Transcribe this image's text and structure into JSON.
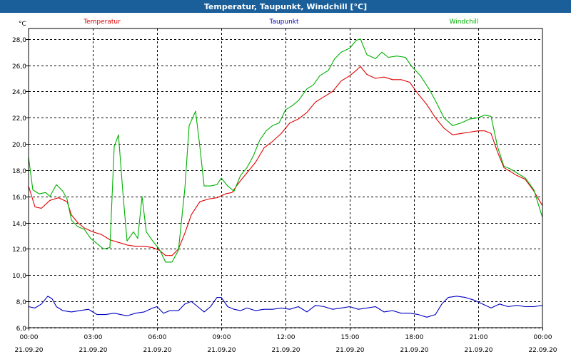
{
  "window": {
    "title": "Temperatur, Taupunkt, Windchill [°C]"
  },
  "colors": {
    "titlebar": "#1a5e9a",
    "temperatur": "#e00000",
    "taupunkt": "#0000c0",
    "windchill": "#00b000",
    "grid": "#000000"
  },
  "chart_data": {
    "type": "line",
    "title": "Temperatur, Taupunkt, Windchill [°C]",
    "ylabel": "°C",
    "ylim": [
      6.0,
      28.8
    ],
    "yticks": [
      "28,0",
      "26,0",
      "24,0",
      "22,0",
      "20,0",
      "18,0",
      "16,0",
      "14,0",
      "12,0",
      "10,0",
      "8,0",
      "6,0"
    ],
    "ytick_values": [
      28,
      26,
      24,
      22,
      20,
      18,
      16,
      14,
      12,
      10,
      8,
      6
    ],
    "xlim": [
      0,
      24
    ],
    "xticks": [
      {
        "time": "00:00",
        "date": "21.09.20"
      },
      {
        "time": "03:00",
        "date": "21.09.20"
      },
      {
        "time": "06:00",
        "date": "21.09.20"
      },
      {
        "time": "09:00",
        "date": "21.09.20"
      },
      {
        "time": "12:00",
        "date": "21.09.20"
      },
      {
        "time": "15:00",
        "date": "21.09.20"
      },
      {
        "time": "18:00",
        "date": "21.09.20"
      },
      {
        "time": "21:00",
        "date": "21.09.20"
      },
      {
        "time": "00:00",
        "date": "22.09.20"
      }
    ],
    "grid": true,
    "legend_position": "top",
    "series": [
      {
        "name": "Temperatur",
        "color": "#e00000",
        "points": [
          [
            0,
            16.8
          ],
          [
            0.3,
            15.2
          ],
          [
            0.6,
            15.1
          ],
          [
            1.0,
            15.7
          ],
          [
            1.4,
            15.9
          ],
          [
            1.8,
            15.6
          ],
          [
            2.0,
            14.6
          ],
          [
            2.3,
            14.0
          ],
          [
            2.6,
            13.6
          ],
          [
            3.0,
            13.3
          ],
          [
            3.4,
            13.1
          ],
          [
            3.8,
            12.7
          ],
          [
            4.2,
            12.5
          ],
          [
            4.6,
            12.3
          ],
          [
            5.0,
            12.2
          ],
          [
            5.4,
            12.2
          ],
          [
            5.8,
            12.1
          ],
          [
            6.1,
            11.9
          ],
          [
            6.4,
            11.5
          ],
          [
            6.7,
            11.5
          ],
          [
            7.0,
            12.0
          ],
          [
            7.3,
            13.2
          ],
          [
            7.6,
            14.6
          ],
          [
            8.0,
            15.6
          ],
          [
            8.4,
            15.8
          ],
          [
            8.8,
            15.9
          ],
          [
            9.2,
            16.2
          ],
          [
            9.5,
            16.3
          ],
          [
            9.8,
            17.0
          ],
          [
            10.2,
            17.8
          ],
          [
            10.6,
            18.6
          ],
          [
            11.0,
            19.7
          ],
          [
            11.4,
            20.2
          ],
          [
            11.8,
            20.8
          ],
          [
            12.2,
            21.6
          ],
          [
            12.6,
            21.9
          ],
          [
            13.0,
            22.4
          ],
          [
            13.4,
            23.2
          ],
          [
            13.8,
            23.6
          ],
          [
            14.2,
            24.0
          ],
          [
            14.6,
            24.8
          ],
          [
            15.0,
            25.2
          ],
          [
            15.3,
            25.6
          ],
          [
            15.5,
            25.9
          ],
          [
            15.8,
            25.3
          ],
          [
            16.2,
            25.0
          ],
          [
            16.6,
            25.1
          ],
          [
            17.0,
            24.9
          ],
          [
            17.4,
            24.9
          ],
          [
            17.8,
            24.7
          ],
          [
            18.2,
            23.8
          ],
          [
            18.6,
            23.0
          ],
          [
            19.0,
            22.0
          ],
          [
            19.4,
            21.2
          ],
          [
            19.8,
            20.7
          ],
          [
            20.2,
            20.8
          ],
          [
            20.6,
            20.9
          ],
          [
            21.0,
            21.0
          ],
          [
            21.3,
            21.0
          ],
          [
            21.6,
            20.8
          ],
          [
            21.9,
            19.4
          ],
          [
            22.2,
            18.2
          ],
          [
            22.5,
            17.9
          ],
          [
            22.8,
            17.6
          ],
          [
            23.2,
            17.3
          ],
          [
            23.6,
            16.4
          ],
          [
            24.0,
            15.3
          ]
        ]
      },
      {
        "name": "Taupunkt",
        "color": "#0000c0",
        "points": [
          [
            0,
            7.6
          ],
          [
            0.3,
            7.5
          ],
          [
            0.6,
            7.8
          ],
          [
            0.9,
            8.4
          ],
          [
            1.1,
            8.2
          ],
          [
            1.3,
            7.6
          ],
          [
            1.6,
            7.3
          ],
          [
            2.0,
            7.2
          ],
          [
            2.4,
            7.3
          ],
          [
            2.8,
            7.4
          ],
          [
            3.2,
            7.0
          ],
          [
            3.6,
            7.0
          ],
          [
            4.0,
            7.1
          ],
          [
            4.3,
            7.0
          ],
          [
            4.6,
            6.9
          ],
          [
            5.0,
            7.1
          ],
          [
            5.4,
            7.2
          ],
          [
            5.8,
            7.5
          ],
          [
            6.0,
            7.6
          ],
          [
            6.3,
            7.1
          ],
          [
            6.6,
            7.3
          ],
          [
            7.0,
            7.3
          ],
          [
            7.3,
            7.8
          ],
          [
            7.6,
            8.0
          ],
          [
            7.9,
            7.6
          ],
          [
            8.2,
            7.2
          ],
          [
            8.5,
            7.6
          ],
          [
            8.8,
            8.3
          ],
          [
            9.0,
            8.3
          ],
          [
            9.3,
            7.6
          ],
          [
            9.6,
            7.4
          ],
          [
            9.9,
            7.3
          ],
          [
            10.2,
            7.5
          ],
          [
            10.6,
            7.3
          ],
          [
            11.0,
            7.4
          ],
          [
            11.4,
            7.4
          ],
          [
            11.8,
            7.5
          ],
          [
            12.2,
            7.4
          ],
          [
            12.6,
            7.6
          ],
          [
            13.0,
            7.2
          ],
          [
            13.4,
            7.7
          ],
          [
            13.8,
            7.6
          ],
          [
            14.2,
            7.4
          ],
          [
            14.6,
            7.5
          ],
          [
            15.0,
            7.6
          ],
          [
            15.4,
            7.4
          ],
          [
            15.8,
            7.5
          ],
          [
            16.2,
            7.6
          ],
          [
            16.6,
            7.2
          ],
          [
            17.0,
            7.3
          ],
          [
            17.4,
            7.1
          ],
          [
            17.8,
            7.1
          ],
          [
            18.2,
            7.0
          ],
          [
            18.6,
            6.8
          ],
          [
            19.0,
            7.0
          ],
          [
            19.3,
            7.8
          ],
          [
            19.6,
            8.3
          ],
          [
            20.0,
            8.4
          ],
          [
            20.4,
            8.3
          ],
          [
            20.8,
            8.1
          ],
          [
            21.2,
            7.8
          ],
          [
            21.6,
            7.5
          ],
          [
            22.0,
            7.8
          ],
          [
            22.4,
            7.6
          ],
          [
            22.8,
            7.7
          ],
          [
            23.2,
            7.6
          ],
          [
            23.6,
            7.6
          ],
          [
            24.0,
            7.7
          ]
        ]
      },
      {
        "name": "Windchill",
        "color": "#00b000",
        "points": [
          [
            0,
            19.0
          ],
          [
            0.2,
            16.5
          ],
          [
            0.5,
            16.2
          ],
          [
            0.8,
            16.3
          ],
          [
            1.0,
            16.0
          ],
          [
            1.3,
            16.9
          ],
          [
            1.6,
            16.4
          ],
          [
            1.8,
            15.8
          ],
          [
            2.0,
            14.2
          ],
          [
            2.3,
            13.7
          ],
          [
            2.6,
            13.5
          ],
          [
            2.9,
            12.8
          ],
          [
            3.2,
            12.4
          ],
          [
            3.5,
            12.0
          ],
          [
            3.8,
            12.1
          ],
          [
            4.0,
            19.8
          ],
          [
            4.2,
            20.7
          ],
          [
            4.4,
            16.4
          ],
          [
            4.6,
            12.6
          ],
          [
            4.9,
            13.3
          ],
          [
            5.1,
            12.8
          ],
          [
            5.3,
            16.0
          ],
          [
            5.5,
            13.3
          ],
          [
            5.8,
            12.6
          ],
          [
            6.1,
            12.0
          ],
          [
            6.4,
            11.0
          ],
          [
            6.7,
            11.0
          ],
          [
            7.0,
            11.9
          ],
          [
            7.3,
            16.6
          ],
          [
            7.5,
            21.4
          ],
          [
            7.8,
            22.5
          ],
          [
            8.0,
            19.8
          ],
          [
            8.2,
            16.8
          ],
          [
            8.5,
            16.8
          ],
          [
            8.8,
            16.9
          ],
          [
            9.0,
            17.4
          ],
          [
            9.3,
            16.8
          ],
          [
            9.6,
            16.4
          ],
          [
            9.9,
            17.6
          ],
          [
            10.2,
            18.2
          ],
          [
            10.5,
            19.1
          ],
          [
            10.8,
            20.3
          ],
          [
            11.1,
            21.0
          ],
          [
            11.4,
            21.4
          ],
          [
            11.7,
            21.6
          ],
          [
            12.0,
            22.6
          ],
          [
            12.3,
            22.9
          ],
          [
            12.6,
            23.3
          ],
          [
            13.0,
            24.2
          ],
          [
            13.3,
            24.5
          ],
          [
            13.6,
            25.2
          ],
          [
            14.0,
            25.6
          ],
          [
            14.3,
            26.5
          ],
          [
            14.6,
            27.0
          ],
          [
            15.0,
            27.3
          ],
          [
            15.3,
            27.9
          ],
          [
            15.5,
            28.0
          ],
          [
            15.8,
            26.8
          ],
          [
            16.2,
            26.5
          ],
          [
            16.5,
            27.0
          ],
          [
            16.8,
            26.6
          ],
          [
            17.2,
            26.7
          ],
          [
            17.6,
            26.6
          ],
          [
            17.9,
            25.9
          ],
          [
            18.3,
            25.2
          ],
          [
            18.7,
            24.2
          ],
          [
            19.0,
            23.3
          ],
          [
            19.4,
            22.0
          ],
          [
            19.8,
            21.4
          ],
          [
            20.2,
            21.6
          ],
          [
            20.6,
            21.9
          ],
          [
            21.0,
            22.0
          ],
          [
            21.3,
            22.2
          ],
          [
            21.6,
            22.1
          ],
          [
            21.9,
            19.8
          ],
          [
            22.2,
            18.3
          ],
          [
            22.5,
            18.1
          ],
          [
            22.8,
            17.8
          ],
          [
            23.2,
            17.4
          ],
          [
            23.6,
            16.5
          ],
          [
            24.0,
            14.4
          ]
        ]
      }
    ]
  }
}
